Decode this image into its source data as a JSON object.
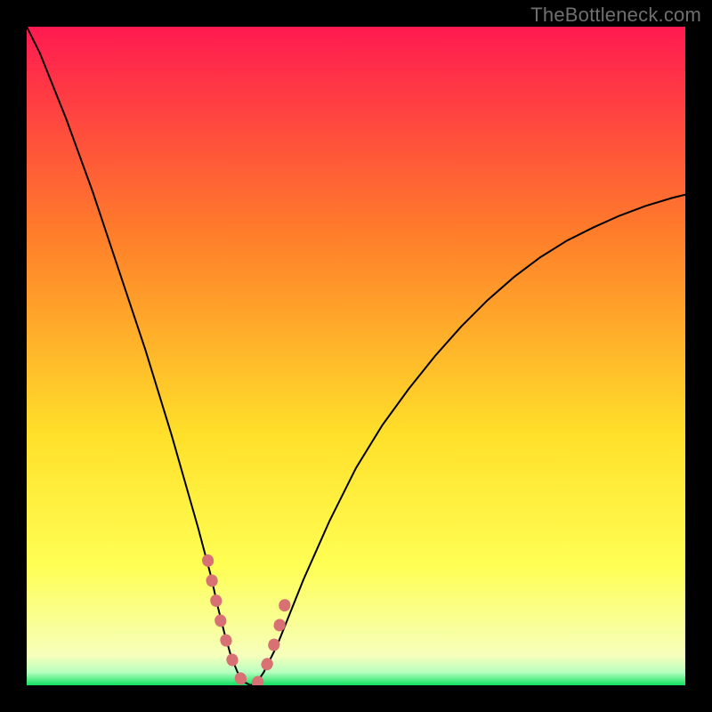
{
  "watermark": "TheBottleneck.com",
  "colors": {
    "frame": "#000000",
    "curve": "#000000",
    "highlight": "#d87173",
    "gradient_top": "#ff1a50",
    "gradient_mid_upper": "#ff7f2a",
    "gradient_mid": "#ffe02a",
    "gradient_lower": "#f6ffbb",
    "gradient_bottom": "#10e060"
  },
  "chart_data": {
    "type": "line",
    "title": "",
    "xlabel": "",
    "ylabel": "",
    "xlim": [
      0,
      100
    ],
    "ylim": [
      0,
      100
    ],
    "x": [
      0,
      2,
      4,
      6,
      8,
      10,
      12,
      14,
      16,
      18,
      20,
      22,
      24,
      26,
      28,
      29,
      30,
      31,
      32,
      33,
      34,
      35,
      36,
      38,
      40,
      42,
      44,
      46,
      48,
      50,
      54,
      58,
      62,
      66,
      70,
      74,
      78,
      82,
      86,
      90,
      94,
      98,
      100
    ],
    "values": [
      100,
      96,
      91,
      86,
      80.5,
      75,
      69,
      63,
      57,
      51,
      44.5,
      38,
      31,
      24,
      16.5,
      12,
      8,
      4.5,
      2,
      0.5,
      0,
      0.5,
      2,
      6,
      11,
      16,
      20.5,
      25,
      29,
      33,
      39.5,
      45,
      50,
      54.5,
      58.5,
      62,
      65,
      67.5,
      69.5,
      71.3,
      72.8,
      74,
      74.5
    ],
    "highlight_region": {
      "x": [
        27.5,
        28.5,
        29.5,
        30.5,
        31.5,
        32.5,
        33,
        33.5,
        34,
        34.5,
        35,
        35.5,
        36,
        36.5,
        37.5,
        38.5,
        39.5
      ],
      "y": [
        19,
        14,
        9.5,
        6,
        3,
        1,
        0.4,
        0.1,
        0,
        0.1,
        0.4,
        1,
        2,
        3.2,
        6,
        9.5,
        13.5
      ]
    },
    "green_band_top_y": 3.2
  }
}
